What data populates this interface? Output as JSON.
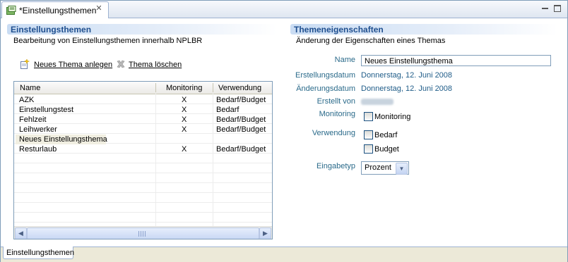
{
  "editor": {
    "tab_title": "*Einstellungsthemen",
    "tab_icon": "editor-tab-icon",
    "close_icon": "close-icon"
  },
  "left": {
    "title": "Einstellungsthemen",
    "description": "Bearbeitung von Einstellungsthemen innerhalb NPLBR",
    "new_link": "Neues Thema anlegen",
    "delete_link": "Thema löschen",
    "table": {
      "columns": [
        "Name",
        "Monitoring",
        "Verwendung"
      ],
      "rows": [
        {
          "name": "AZK",
          "monitoring": "X",
          "verwendung": "Bedarf/Budget"
        },
        {
          "name": "Einstellungstest",
          "monitoring": "X",
          "verwendung": "Bedarf"
        },
        {
          "name": "Fehlzeit",
          "monitoring": "X",
          "verwendung": "Bedarf/Budget"
        },
        {
          "name": "Leihwerker",
          "monitoring": "X",
          "verwendung": "Bedarf/Budget"
        },
        {
          "name": "Neues Einstellungsthema",
          "monitoring": "",
          "verwendung": ""
        },
        {
          "name": "Resturlaub",
          "monitoring": "X",
          "verwendung": "Bedarf/Budget"
        }
      ],
      "selected_row": 4
    }
  },
  "right": {
    "title": "Themeneigenschaften",
    "description": "Änderung der Eigenschaften eines Themas",
    "name_label": "Name",
    "name_value": "Neues Einstellungsthema",
    "erstellungsdatum_label": "Erstellungsdatum",
    "erstellungsdatum_value": "Donnerstag, 12. Juni 2008",
    "aenderungsdatum_label": "Änderungsdatum",
    "aenderungsdatum_value": "Donnerstag, 12. Juni 2008",
    "erstellt_von_label": "Erstellt von",
    "monitoring_label": "Monitoring",
    "monitoring_checkbox": "Monitoring",
    "verwendung_label": "Verwendung",
    "bedarf_checkbox": "Bedarf",
    "budget_checkbox": "Budget",
    "eingabetyp_label": "Eingabetyp",
    "eingabetyp_value": "Prozent"
  },
  "bottom_tab": "Einstellungsthemen",
  "colors": {
    "section_title": "#1f4f8f",
    "property_label": "#2a6a8a",
    "property_value": "#1f5c88"
  }
}
